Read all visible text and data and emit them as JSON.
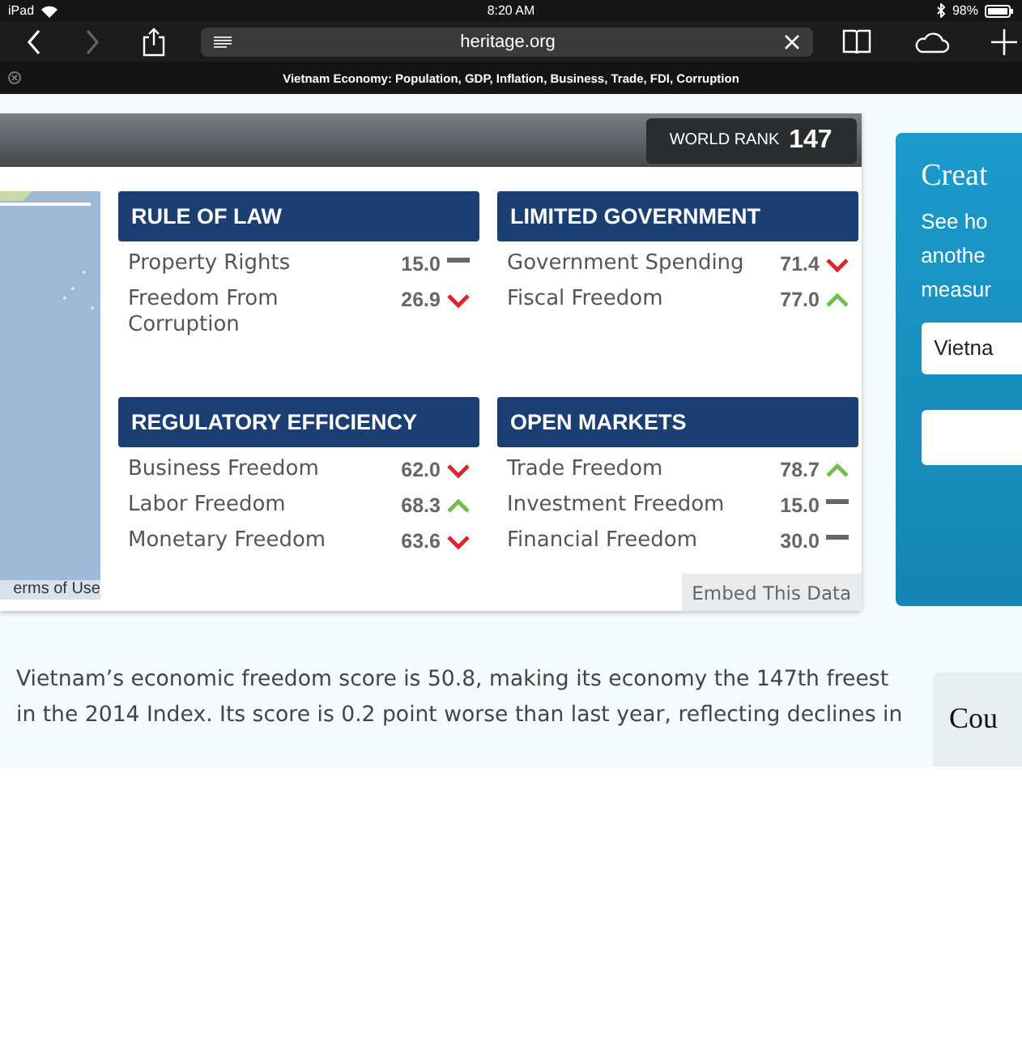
{
  "status_bar": {
    "device": "iPad",
    "time": "8:20 AM",
    "battery": "98%"
  },
  "browser": {
    "url": "heritage.org",
    "forward_disabled": true,
    "page_title": "Vietnam Economy: Population, GDP, Inflation, Business, Trade, FDI, Corruption"
  },
  "world_rank": {
    "label": "WORLD RANK",
    "value": "147"
  },
  "map": {
    "kind": "picture",
    "terms": "erms of Use"
  },
  "categories": [
    {
      "title": "RULE OF LAW",
      "items": [
        {
          "name": "Property Rights",
          "score": "15.0",
          "kind": "flat"
        },
        {
          "name": "Freedom From Corruption",
          "score": "26.9",
          "kind": "down"
        }
      ]
    },
    {
      "title": "LIMITED GOVERNMENT",
      "items": [
        {
          "name": "Government Spending",
          "score": "71.4",
          "kind": "down"
        },
        {
          "name": "Fiscal Freedom",
          "score": "77.0",
          "kind": "up"
        }
      ]
    },
    {
      "title": "REGULATORY EFFICIENCY",
      "items": [
        {
          "name": "Business Freedom",
          "score": "62.0",
          "kind": "down"
        },
        {
          "name": "Labor Freedom",
          "score": "68.3",
          "kind": "up"
        },
        {
          "name": "Monetary Freedom",
          "score": "63.6",
          "kind": "down"
        }
      ]
    },
    {
      "title": "OPEN MARKETS",
      "items": [
        {
          "name": "Trade Freedom",
          "score": "78.7",
          "kind": "up"
        },
        {
          "name": "Investment Freedom",
          "score": "15.0",
          "kind": "flat"
        },
        {
          "name": "Financial Freedom",
          "score": "30.0",
          "kind": "flat"
        }
      ]
    }
  ],
  "embed_button": "Embed This Data",
  "compare_card": {
    "title": "Creat",
    "lines": [
      "See ho",
      "anothe",
      "measur"
    ],
    "country_field": "Vietna"
  },
  "summary": [
    "Vietnam’s economic freedom score is 50.8, making its economy the 147th freest",
    "in the 2014 Index. Its score is 0.2 point worse than last year, reflecting declines in"
  ],
  "side_box": {
    "title": "Cou"
  }
}
